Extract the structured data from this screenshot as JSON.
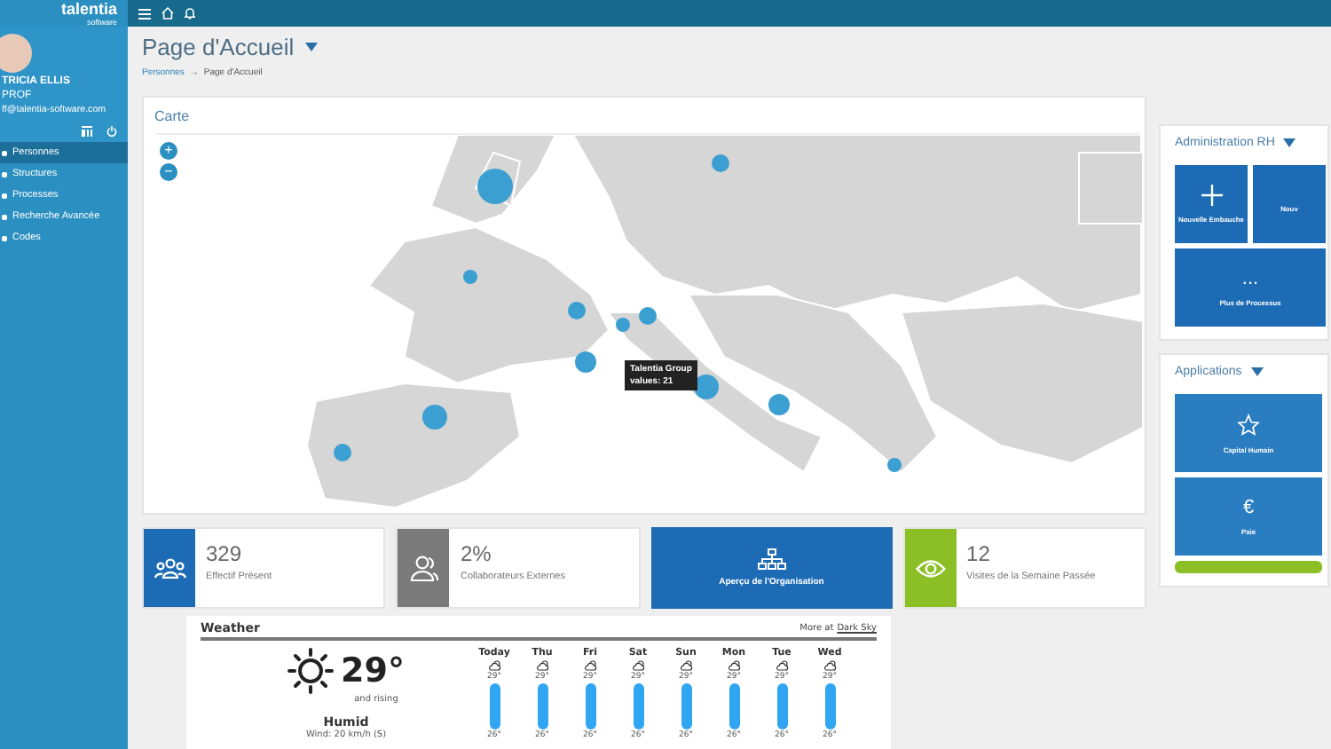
{
  "sidebar": {
    "logo": "talentia",
    "logo_sub": "software",
    "user": {
      "name": "TRICIA ELLIS",
      "role": "PROF",
      "email": "ff@talentia-software.com"
    },
    "items": [
      {
        "label": "Personnes",
        "selected": true
      },
      {
        "label": "Structures",
        "selected": false
      },
      {
        "label": "Processes",
        "selected": false
      },
      {
        "label": "Recherche Avancée",
        "selected": false
      },
      {
        "label": "Codes",
        "selected": false
      }
    ]
  },
  "page": {
    "title": "Page d'Accueil",
    "breadcrumb": [
      "Personnes",
      "→",
      "Page d'Accueil"
    ]
  },
  "map_panel": {
    "title": "Carte",
    "zoom_in": "+",
    "zoom_out": "−",
    "tooltip": {
      "title": "Talentia Group",
      "value": "values: 21"
    }
  },
  "stats": [
    {
      "kind": "stat",
      "value": "329",
      "label": "Effectif Présent",
      "color": "#1d6bb5"
    },
    {
      "kind": "stat",
      "value": "2%",
      "label": "Collaborateurs Externes",
      "color": "#7a7a7a"
    },
    {
      "kind": "action",
      "label": "Aperçu de l'Organisation",
      "color": "#1d6bb5"
    },
    {
      "kind": "stat",
      "value": "12",
      "label": "Visites de la Semaine Passée",
      "color": "#8cbf26"
    }
  ],
  "weather": {
    "title": "Weather",
    "more": "More at",
    "link": "Dark Sky",
    "temp": "29°",
    "trend": "and rising",
    "summary": "Humid",
    "wind": "Wind: 20 km/h (S)",
    "days": [
      {
        "day": "Today",
        "high": "29°",
        "low": "26°"
      },
      {
        "day": "Thu",
        "high": "29°",
        "low": "26°"
      },
      {
        "day": "Fri",
        "high": "29°",
        "low": "26°"
      },
      {
        "day": "Sat",
        "high": "29°",
        "low": "26°"
      },
      {
        "day": "Sun",
        "high": "29°",
        "low": "26°"
      },
      {
        "day": "Mon",
        "high": "29°",
        "low": "26°"
      },
      {
        "day": "Tue",
        "high": "29°",
        "low": "26°"
      },
      {
        "day": "Wed",
        "high": "29°",
        "low": "26°"
      }
    ]
  },
  "admin": {
    "title": "Administration RH",
    "tiles": [
      {
        "kind": "plus",
        "label": "Nouvelle Embauche"
      },
      {
        "kind": "blank",
        "label": "Nouv"
      },
      {
        "kind": "more",
        "label": "Plus de Processus",
        "icon": "..."
      }
    ]
  },
  "applications": {
    "title": "Applications",
    "tiles": [
      {
        "kind": "star",
        "label": "Capital Humain"
      },
      {
        "kind": "euro",
        "label": "Paie",
        "icon": "€"
      },
      {
        "kind": "bar"
      }
    ]
  }
}
